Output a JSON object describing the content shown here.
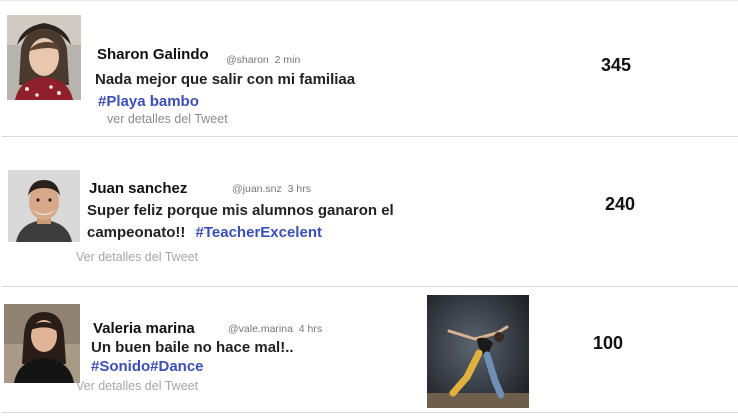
{
  "tweets": [
    {
      "name": "Sharon Galindo",
      "handle": "@sharon",
      "time": "2 min",
      "text": "Nada mejor que salir con mi familiaa",
      "hashtag": "#Playa bambo",
      "details": "ver detalles del Tweet",
      "count": "345"
    },
    {
      "name": "Juan sanchez",
      "handle": "@juan.snz",
      "time": "3 hrs",
      "text_line1": "Super feliz porque mis alumnos ganaron el",
      "text_line2": "campeonato!!",
      "hashtag": "#TeacherExcelent",
      "details": "Ver detalles del Tweet",
      "count": "240"
    },
    {
      "name": "Valeria marina",
      "handle": "@vale.marina",
      "time": "4 hrs",
      "text": "Un buen baile no hace mal!..",
      "hashtag": "#Sonido#Dance",
      "details": "Ver detalles del Tweet",
      "count": "100"
    }
  ],
  "colors": {
    "hashtag": "#3b4fb6",
    "details": "#8c8c8c",
    "separator": "#d7d7d7"
  },
  "icons": [
    "avatar-sharon",
    "avatar-juan",
    "avatar-valeria",
    "dance-photo"
  ]
}
